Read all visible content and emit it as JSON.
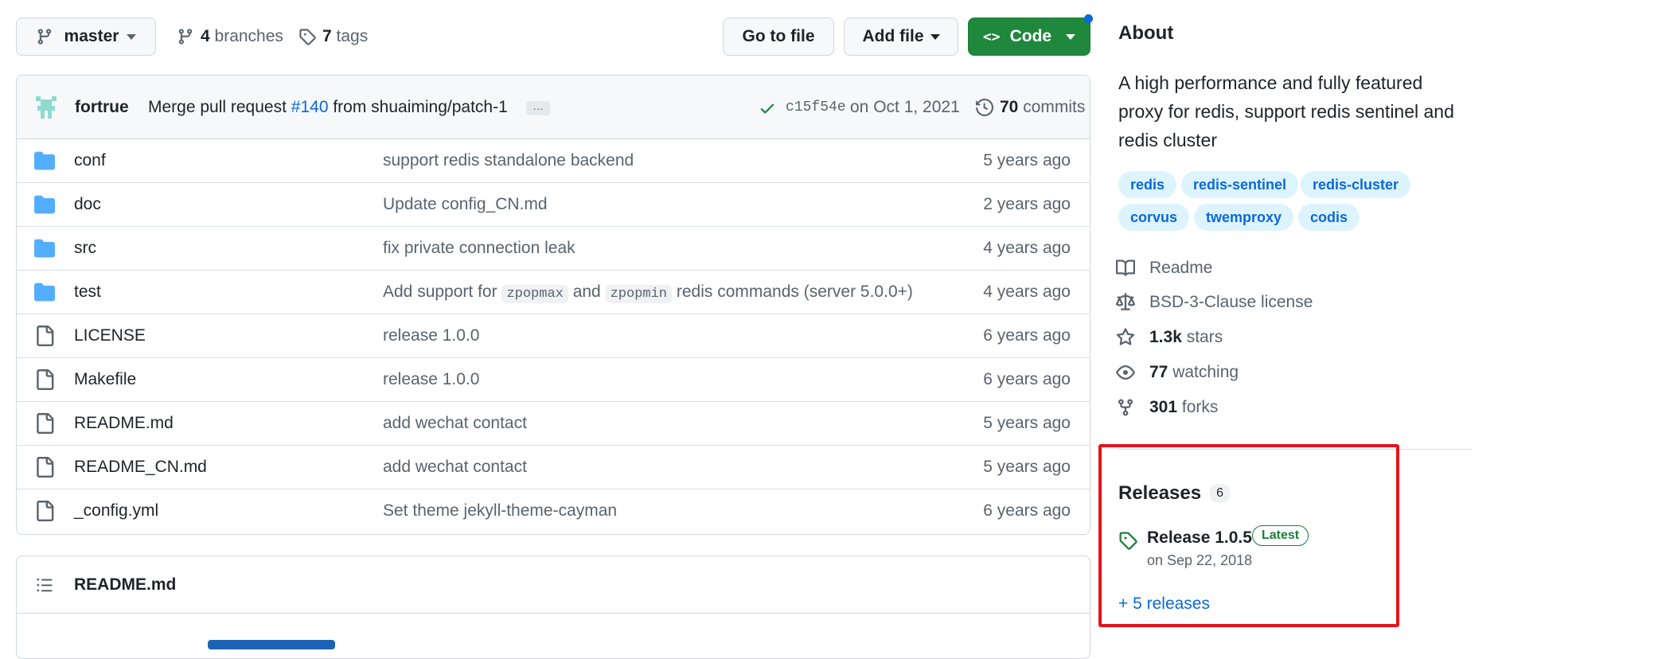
{
  "toolbar": {
    "branch": "master",
    "branches_count": "4",
    "branches_label": "branches",
    "tags_count": "7",
    "tags_label": "tags",
    "go_to_file": "Go to file",
    "add_file": "Add file",
    "code": "Code"
  },
  "commit": {
    "author": "fortrue",
    "message": "Merge pull request",
    "pr": "#140",
    "message_rest": "from shuaiming/patch-1",
    "ellipsis": "…",
    "sha": "c15f54e",
    "date": "on Oct 1, 2021",
    "commits_count": "70",
    "commits_label": "commits"
  },
  "files": [
    {
      "name": "conf",
      "type": "folder",
      "message": "support redis standalone backend",
      "age": "5 years ago"
    },
    {
      "name": "doc",
      "type": "folder",
      "message": "Update config_CN.md",
      "age": "2 years ago"
    },
    {
      "name": "src",
      "type": "folder",
      "message": "fix private connection leak",
      "age": "4 years ago"
    },
    {
      "name": "test",
      "type": "folder",
      "message_parts": [
        "Add support for",
        "zpopmax",
        "and",
        "zpopmin",
        "redis commands (server 5.0.0+)"
      ],
      "age": "4 years ago"
    },
    {
      "name": "LICENSE",
      "type": "file",
      "message": "release 1.0.0",
      "age": "6 years ago"
    },
    {
      "name": "Makefile",
      "type": "file",
      "message": "release 1.0.0",
      "age": "6 years ago"
    },
    {
      "name": "README.md",
      "type": "file",
      "message": "add wechat contact",
      "age": "5 years ago"
    },
    {
      "name": "README_CN.md",
      "type": "file",
      "message": "add wechat contact",
      "age": "5 years ago"
    },
    {
      "name": "_config.yml",
      "type": "file",
      "message": "Set theme jekyll-theme-cayman",
      "age": "6 years ago"
    }
  ],
  "readme": {
    "title": "README.md"
  },
  "about": {
    "heading": "About",
    "description_lines": [
      "A high performance and fully featured",
      "proxy for redis, support redis sentinel and",
      "redis cluster"
    ],
    "topics": [
      "redis",
      "redis-sentinel",
      "redis-cluster",
      "corvus",
      "twemproxy",
      "codis"
    ],
    "readme": "Readme",
    "license": "BSD-3-Clause license",
    "stars_count": "1.3k",
    "stars_label": "stars",
    "watching_count": "77",
    "watching_label": "watching",
    "forks_count": "301",
    "forks_label": "forks"
  },
  "releases": {
    "heading": "Releases",
    "count": "6",
    "latest_name": "Release 1.0.5",
    "latest_badge": "Latest",
    "latest_date": "on Sep 22, 2018",
    "more": "+ 5 releases"
  },
  "colors": {
    "accent": "#0969da",
    "code_button": "#1f883d",
    "highlight_box": "#e5121b",
    "folder": "#54aeff"
  }
}
